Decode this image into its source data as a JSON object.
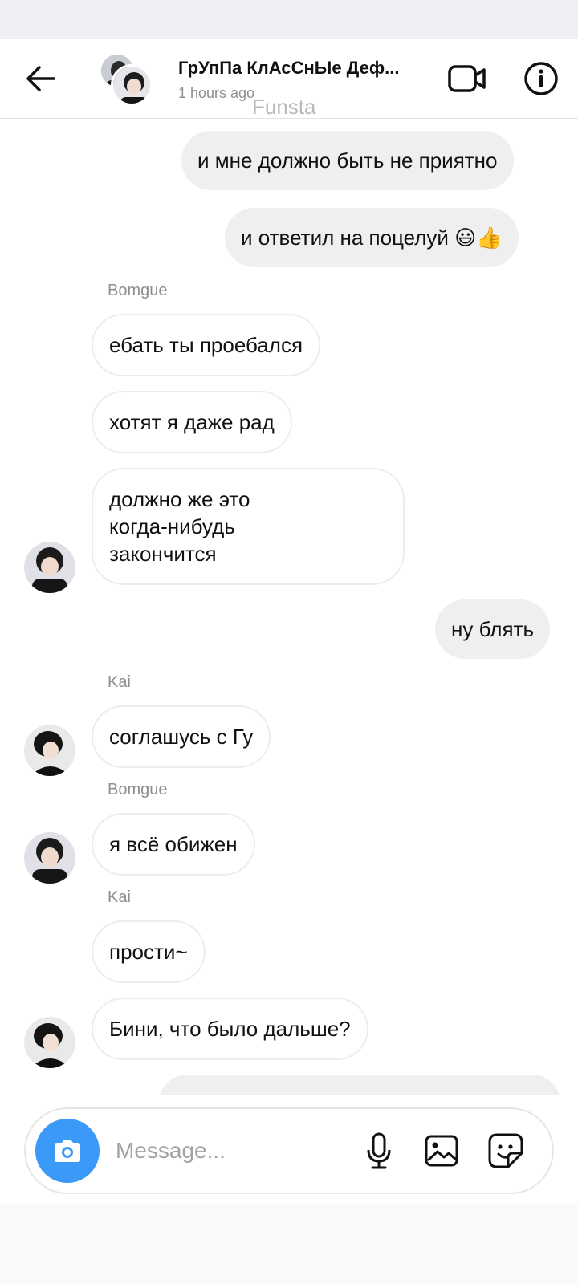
{
  "header": {
    "title": "ГрУпПа КлАсСнЫе Деф...",
    "subtitle": "1 hours ago",
    "watermark": "Funsta"
  },
  "messages": [
    {
      "direction": "out",
      "text": "и мне должно быть не приятно"
    },
    {
      "direction": "out",
      "text": "и ответил на поцелуй 😃👍"
    },
    {
      "direction": "in",
      "sender": "Bomgue",
      "text": "ебать ты проебался"
    },
    {
      "direction": "in",
      "text": "хотят я даже рад"
    },
    {
      "direction": "in",
      "text": "должно же это\nкогда-нибудь\nзакончится"
    },
    {
      "direction": "out",
      "text": "ну блять"
    },
    {
      "direction": "in",
      "sender": "Kai",
      "text": "соглашусь с Гу"
    },
    {
      "direction": "in",
      "sender": "Bomgue",
      "text": "я всё обижен"
    },
    {
      "direction": "in",
      "sender": "Kai",
      "text": "прости~"
    },
    {
      "direction": "in",
      "text": "Бини, что было дальше?"
    }
  ],
  "composer": {
    "placeholder": "Message..."
  },
  "colors": {
    "accent": "#3b9af8",
    "outgoing_bubble": "#efefef",
    "secondary_text": "#8e8e8e"
  },
  "icons": [
    "back-arrow-icon",
    "video-camera-icon",
    "info-icon",
    "camera-icon",
    "microphone-icon",
    "gallery-icon",
    "sticker-icon"
  ]
}
